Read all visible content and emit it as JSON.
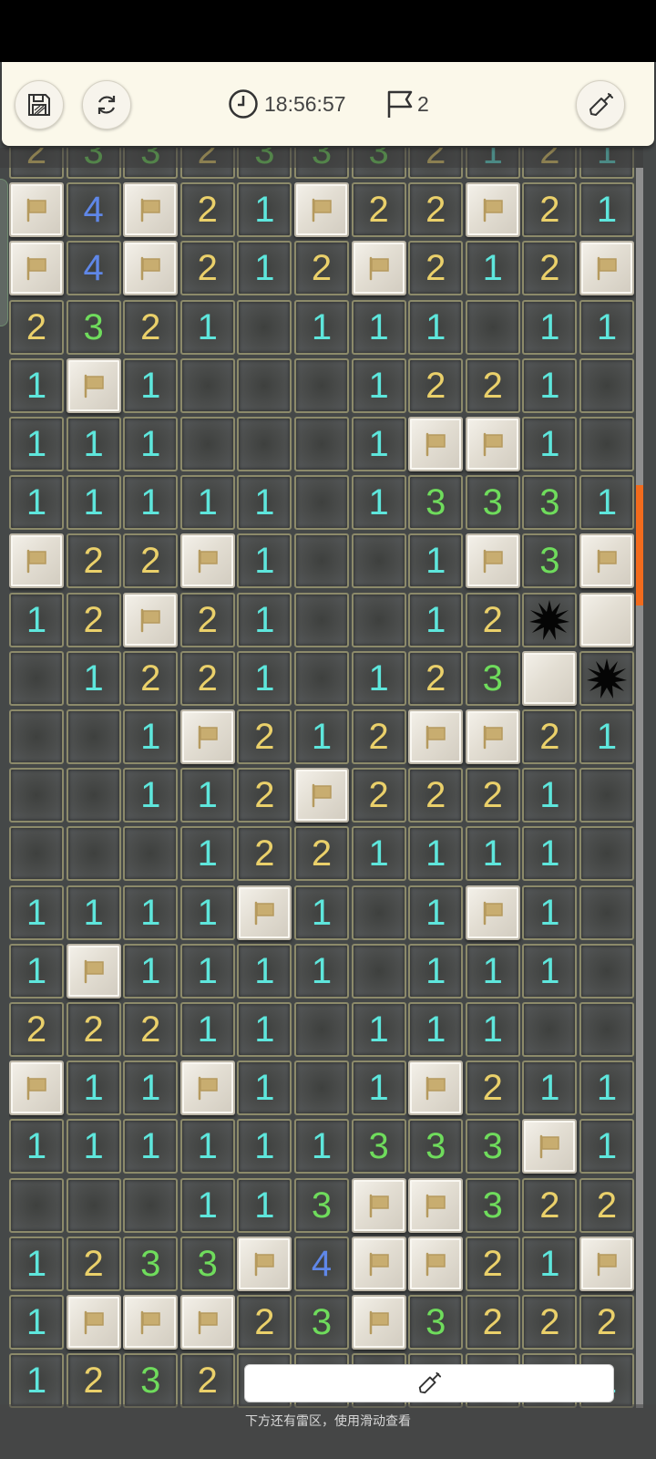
{
  "toolbar": {
    "save_icon": "save-icon",
    "restart_icon": "restart-icon",
    "timer_icon": "clock-icon",
    "timer_value": "18:56:57",
    "flag_icon": "flag-outline-icon",
    "flag_count": "2",
    "mode_icon": "shovel-icon"
  },
  "board": {
    "legend": "row strings: 1-4 = revealed number, F = flagged, . = revealed empty, S = unrevealed stone, X = exploded mine",
    "rows": [
      "23323332121",
      "F4F21F22F21",
      "F4F212F212F",
      "2321.111.11",
      "1F1...1221.",
      "111...1FF1.",
      "11111.13331",
      "F22F1..1F3F",
      "12F21..12XS",
      ".1221.123SX",
      "..1F212FF21",
      "..112F2221.",
      "...1221111.",
      "1111F1.1F1.",
      "1F1111.111.",
      "22211.111..",
      "F11F1.1F211",
      "111111333F1",
      "...113FF322",
      "1233F4FF21F",
      "1FFF23F3222",
      "12321111221"
    ],
    "colors": {
      "1": "#5ee6dc",
      "2": "#ead06a",
      "3": "#6fdc5c",
      "4": "#5f87e8"
    }
  },
  "dig_button_icon": "shovel-icon",
  "hint_text": "下方还有雷区，使用滑动查看"
}
